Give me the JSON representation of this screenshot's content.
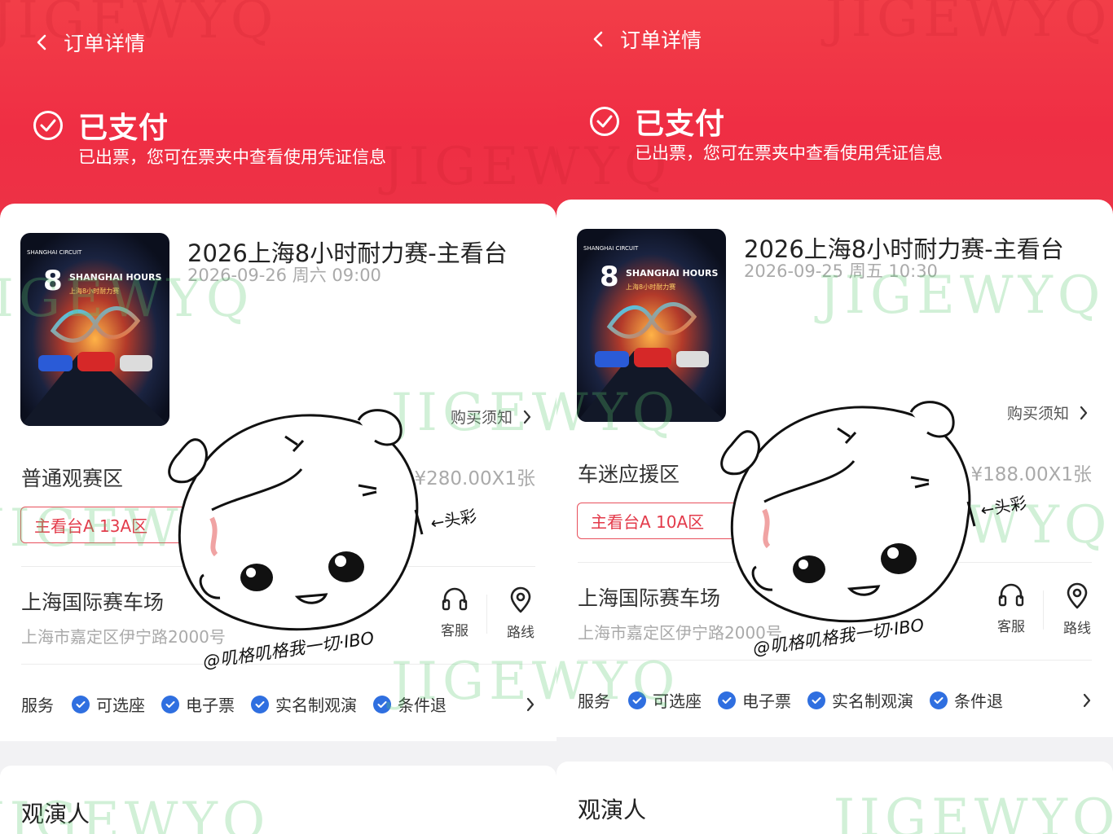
{
  "screens": [
    {
      "nav_title": "订单详情",
      "status_title": "已支付",
      "status_sub": "已出票，您可在票夹中查看使用凭证信息",
      "event_title": "2026上海8小时耐力赛-主看台",
      "event_time": "2026-09-26 周六 09:00",
      "notice_label": "购买须知",
      "zone_name": "普通观赛区",
      "price": "¥280.00X1张",
      "seat_tag": "主看台A 13A区",
      "venue": "上海国际赛车场",
      "address": "上海市嘉定区伊宁路2000号",
      "service_action_label": "客服",
      "route_action_label": "路线",
      "services_label": "服务",
      "services": [
        "可选座",
        "电子票",
        "实名制观演",
        "条件退"
      ],
      "attendee_label": "观演人"
    },
    {
      "nav_title": "订单详情",
      "status_title": "已支付",
      "status_sub": "已出票，您可在票夹中查看使用凭证信息",
      "event_title": "2026上海8小时耐力赛-主看台",
      "event_time": "2026-09-25 周五 10:30",
      "notice_label": "购买须知",
      "zone_name": "车迷应援区",
      "price": "¥188.00X1张",
      "seat_tag": "主看台A 10A区",
      "venue": "上海国际赛车场",
      "address": "上海市嘉定区伊宁路2000号",
      "service_action_label": "客服",
      "route_action_label": "路线",
      "services_label": "服务",
      "services": [
        "可选座",
        "电子票",
        "实名制观演",
        "条件退"
      ],
      "attendee_label": "观演人"
    }
  ],
  "poster": {
    "brand": "SHANGHAI CIRCUIT",
    "number": "8",
    "headline": "SHANGHAI HOURS",
    "cn_headline": "上海8小时耐力赛"
  },
  "overlay": {
    "watermark": "JIGEWYQ",
    "sticker_note": "@叽格叽格我一切·IBO",
    "sticker_arrow": "←头彩"
  },
  "colors": {
    "hero_red": "#ef2e44",
    "seat_red": "#e33b4b",
    "check_blue": "#2f6fe0"
  },
  "icons": [
    "chevron-left-icon",
    "check-circle-icon",
    "chevron-right-icon",
    "headset-icon",
    "location-pin-icon",
    "check-icon"
  ]
}
